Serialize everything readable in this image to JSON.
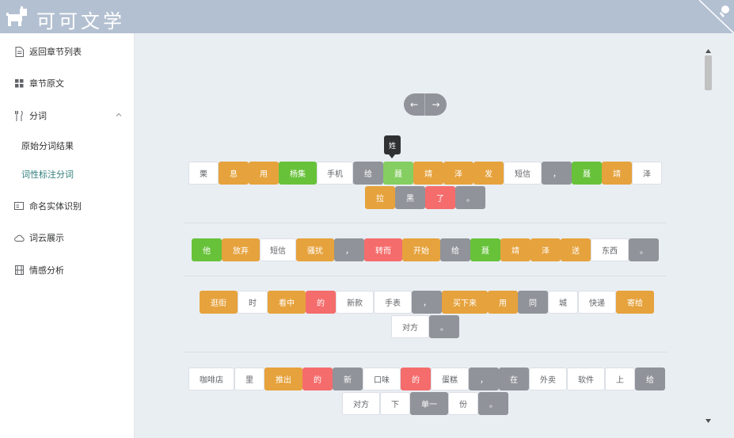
{
  "header": {
    "brand": "可可文学"
  },
  "sidebar": {
    "items": [
      {
        "label": "返回章节列表",
        "icon": "document-icon"
      },
      {
        "label": "章节原文",
        "icon": "grid-icon"
      },
      {
        "label": "分词",
        "icon": "fork-icon"
      },
      {
        "label": "原始分词结果"
      },
      {
        "label": "词性标注分词"
      },
      {
        "label": "命名实体识别",
        "icon": "id-card-icon"
      },
      {
        "label": "词云展示",
        "icon": "cloud-icon"
      },
      {
        "label": "情感分析",
        "icon": "film-icon"
      }
    ]
  },
  "nav": {
    "prev": "←",
    "next": "→"
  },
  "tooltip": {
    "text": "姓"
  },
  "sentences": [
    {
      "rows": [
        [
          {
            "t": "栗",
            "c": "white"
          },
          {
            "t": "息",
            "c": "orange"
          },
          {
            "t": "用",
            "c": "orange"
          },
          {
            "t": "杨集",
            "c": "green"
          },
          {
            "t": "手机",
            "c": "white"
          },
          {
            "t": "给",
            "c": "gray"
          },
          {
            "t": "聂",
            "c": "lightgreen"
          },
          {
            "t": "靖",
            "c": "orange"
          },
          {
            "t": "泽",
            "c": "orange"
          },
          {
            "t": "发",
            "c": "orange"
          },
          {
            "t": "短信",
            "c": "white"
          },
          {
            "t": "，",
            "c": "gray"
          },
          {
            "t": "聂",
            "c": "green"
          },
          {
            "t": "靖",
            "c": "orange"
          },
          {
            "t": "泽",
            "c": "white"
          }
        ],
        [
          {
            "t": "拉",
            "c": "orange"
          },
          {
            "t": "黑",
            "c": "gray"
          },
          {
            "t": "了",
            "c": "red"
          },
          {
            "t": "。",
            "c": "gray"
          }
        ]
      ]
    },
    {
      "rows": [
        [
          {
            "t": "他",
            "c": "green"
          },
          {
            "t": "放弃",
            "c": "orange"
          },
          {
            "t": "短信",
            "c": "white"
          },
          {
            "t": "骚扰",
            "c": "orange"
          },
          {
            "t": "，",
            "c": "gray"
          },
          {
            "t": "转而",
            "c": "red"
          },
          {
            "t": "开始",
            "c": "orange"
          },
          {
            "t": "给",
            "c": "gray"
          },
          {
            "t": "聂",
            "c": "green"
          },
          {
            "t": "靖",
            "c": "orange"
          },
          {
            "t": "泽",
            "c": "orange"
          },
          {
            "t": "送",
            "c": "orange"
          },
          {
            "t": "东西",
            "c": "white"
          },
          {
            "t": "。",
            "c": "gray"
          }
        ]
      ]
    },
    {
      "rows": [
        [
          {
            "t": "逛街",
            "c": "orange"
          },
          {
            "t": "时",
            "c": "white"
          },
          {
            "t": "看中",
            "c": "orange"
          },
          {
            "t": "的",
            "c": "red"
          },
          {
            "t": "新款",
            "c": "white"
          },
          {
            "t": "手表",
            "c": "white"
          },
          {
            "t": "，",
            "c": "gray"
          },
          {
            "t": "买下来",
            "c": "orange"
          },
          {
            "t": "用",
            "c": "orange"
          },
          {
            "t": "同",
            "c": "gray"
          },
          {
            "t": "城",
            "c": "white"
          },
          {
            "t": "快递",
            "c": "white"
          },
          {
            "t": "寄给",
            "c": "orange"
          }
        ],
        [
          {
            "t": "对方",
            "c": "white"
          },
          {
            "t": "。",
            "c": "gray"
          }
        ]
      ]
    },
    {
      "rows": [
        [
          {
            "t": "咖啡店",
            "c": "white"
          },
          {
            "t": "里",
            "c": "white"
          },
          {
            "t": "推出",
            "c": "orange"
          },
          {
            "t": "的",
            "c": "red"
          },
          {
            "t": "新",
            "c": "gray"
          },
          {
            "t": "口味",
            "c": "white"
          },
          {
            "t": "的",
            "c": "red"
          },
          {
            "t": "蛋糕",
            "c": "white"
          },
          {
            "t": "，",
            "c": "gray"
          },
          {
            "t": "在",
            "c": "gray"
          },
          {
            "t": "外卖",
            "c": "white"
          },
          {
            "t": "软件",
            "c": "white"
          },
          {
            "t": "上",
            "c": "white"
          },
          {
            "t": "给",
            "c": "gray"
          }
        ],
        [
          {
            "t": "对方",
            "c": "white"
          },
          {
            "t": "下",
            "c": "white"
          },
          {
            "t": "单一",
            "c": "gray"
          },
          {
            "t": "份",
            "c": "white"
          },
          {
            "t": "。",
            "c": "gray"
          }
        ]
      ]
    }
  ]
}
